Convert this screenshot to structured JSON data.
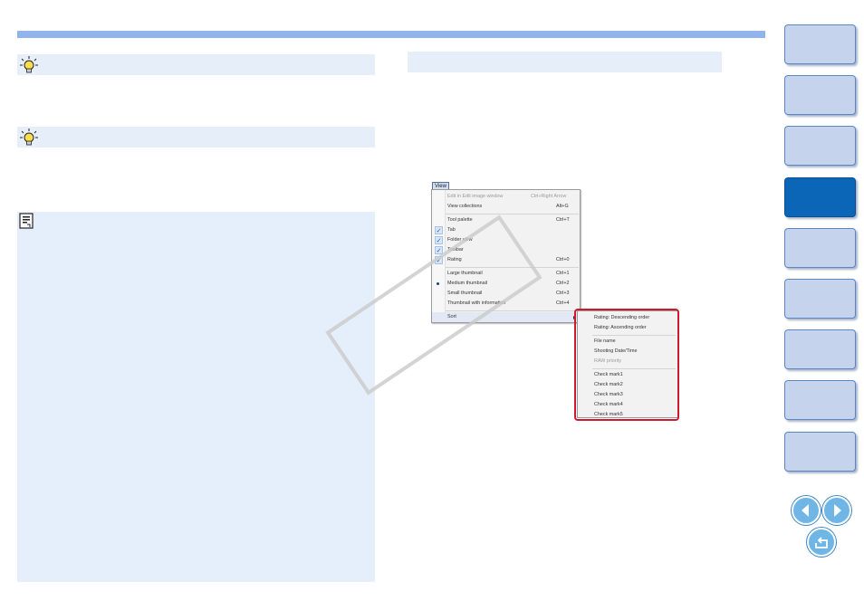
{
  "menu": {
    "tab_label": "View",
    "items": [
      {
        "label": "Edit in Edit image window",
        "shortcut": "Ctrl+Right Arrow",
        "disabled": true
      },
      {
        "label": "View collections",
        "shortcut": "Alt+G"
      },
      {
        "label": "Tool palette",
        "shortcut": "Ctrl+T"
      },
      {
        "label": "Tab",
        "shortcut": "",
        "checked": true
      },
      {
        "label": "Folder view",
        "shortcut": "",
        "checked": true
      },
      {
        "label": "Toolbar",
        "shortcut": "",
        "checked": true
      },
      {
        "label": "Rating",
        "shortcut": "Ctrl+0",
        "checked": true
      },
      {
        "label": "Large thumbnail",
        "shortcut": "Ctrl+1"
      },
      {
        "label": "Medium thumbnail",
        "shortcut": "Ctrl+2",
        "selected": true
      },
      {
        "label": "Small thumbnail",
        "shortcut": "Ctrl+3"
      },
      {
        "label": "Thumbnail with information",
        "shortcut": "Ctrl+4"
      },
      {
        "label": "Sort",
        "shortcut": "",
        "submenu": true
      }
    ]
  },
  "submenu": {
    "items": [
      {
        "label": "Rating: Descending order"
      },
      {
        "label": "Rating: Ascending order"
      },
      {
        "label": "File name"
      },
      {
        "label": "Shooting Date/Time"
      },
      {
        "label": "RAW priority",
        "disabled": true
      },
      {
        "label": "Check mark1"
      },
      {
        "label": "Check mark2"
      },
      {
        "label": "Check mark3"
      },
      {
        "label": "Check mark4"
      },
      {
        "label": "Check mark5"
      }
    ]
  },
  "colors": {
    "accent_bar": "#91b4ea",
    "panel_bg": "#e5eefb",
    "highlight_outline": "#d2182f",
    "active_tab": "#0c66b8",
    "tab": "#c5d4ec"
  },
  "icons": {
    "hint": "lightbulb-icon",
    "note": "memo-icon",
    "prev": "arrow-left-icon",
    "next": "arrow-right-icon",
    "back": "return-icon"
  }
}
